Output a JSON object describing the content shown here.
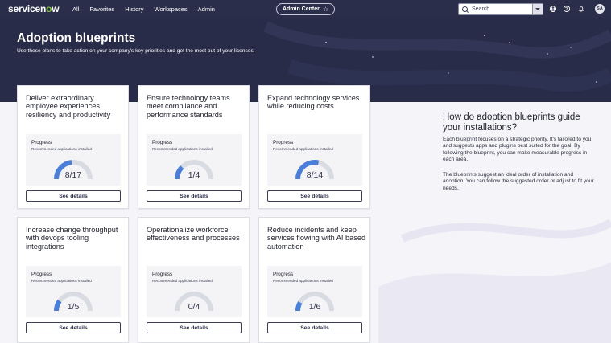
{
  "nav": {
    "logo_text": "servicen",
    "logo_o": "o",
    "logo_tail": "w",
    "menu": [
      "All",
      "Favorites",
      "History",
      "Workspaces",
      "Admin"
    ],
    "context_label": "Admin Center",
    "search_placeholder": "Search",
    "icons": [
      "globe-icon",
      "help-icon",
      "bell-icon"
    ],
    "avatar_initials": "SA"
  },
  "hero": {
    "title": "Adoption blueprints",
    "subtitle": "Use these plans to take action on your company's key priorities and get the most out of your licenses."
  },
  "cards": [
    {
      "title": "Deliver extraordinary employee experiences, resiliency and productivity",
      "progress_label": "Progress",
      "progress_sub": "Recommended applications installed",
      "installed": 8,
      "total": 17,
      "value_text": "8/17",
      "button": "See details"
    },
    {
      "title": "Ensure technology teams meet compliance and performance standards",
      "progress_label": "Progress",
      "progress_sub": "Recommended applications installed",
      "installed": 1,
      "total": 4,
      "value_text": "1/4",
      "button": "See details"
    },
    {
      "title": "Expand technology services while reducing costs",
      "progress_label": "Progress",
      "progress_sub": "Recommended applications installed",
      "installed": 8,
      "total": 14,
      "value_text": "8/14",
      "button": "See details"
    },
    {
      "title": "Increase change throughput with devops tooling integrations",
      "progress_label": "Progress",
      "progress_sub": "Recommended applications installed",
      "installed": 1,
      "total": 5,
      "value_text": "1/5",
      "button": "See details"
    },
    {
      "title": "Operationalize workforce effectiveness and processes",
      "progress_label": "Progress",
      "progress_sub": "Recommended applications installed",
      "installed": 0,
      "total": 4,
      "value_text": "0/4",
      "button": "See details"
    },
    {
      "title": "Reduce incidents and keep services flowing with AI based automation",
      "progress_label": "Progress",
      "progress_sub": "Recommended applications installed",
      "installed": 1,
      "total": 6,
      "value_text": "1/6",
      "button": "See details"
    }
  ],
  "info": {
    "heading": "How do adoption blueprints guide your installations?",
    "para1": "Each blueprint focuses on a strategic priority. It's tailored to you and suggests apps and plugins best suited for the goal. By following the blueprint, you can make measurable progress in each area.",
    "para2": "The blueprints suggest an ideal order of installation and adoption. You can follow the suggested order or adjust to fit your needs."
  },
  "colors": {
    "nav_bg": "#2b2e4a",
    "hero_bg": "#292c48",
    "gauge_fill": "#4a7fd9",
    "gauge_track": "#d9dbe3",
    "accent_green": "#7fc241"
  }
}
